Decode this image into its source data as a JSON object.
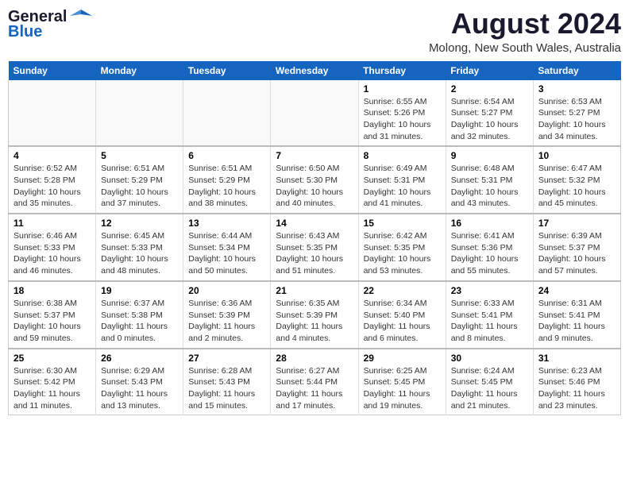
{
  "header": {
    "logo_line1": "General",
    "logo_line2": "Blue",
    "month_year": "August 2024",
    "location": "Molong, New South Wales, Australia"
  },
  "days_of_week": [
    "Sunday",
    "Monday",
    "Tuesday",
    "Wednesday",
    "Thursday",
    "Friday",
    "Saturday"
  ],
  "weeks": [
    [
      {
        "day": "",
        "info": ""
      },
      {
        "day": "",
        "info": ""
      },
      {
        "day": "",
        "info": ""
      },
      {
        "day": "",
        "info": ""
      },
      {
        "day": "1",
        "info": "Sunrise: 6:55 AM\nSunset: 5:26 PM\nDaylight: 10 hours and 31 minutes."
      },
      {
        "day": "2",
        "info": "Sunrise: 6:54 AM\nSunset: 5:27 PM\nDaylight: 10 hours and 32 minutes."
      },
      {
        "day": "3",
        "info": "Sunrise: 6:53 AM\nSunset: 5:27 PM\nDaylight: 10 hours and 34 minutes."
      }
    ],
    [
      {
        "day": "4",
        "info": "Sunrise: 6:52 AM\nSunset: 5:28 PM\nDaylight: 10 hours and 35 minutes."
      },
      {
        "day": "5",
        "info": "Sunrise: 6:51 AM\nSunset: 5:29 PM\nDaylight: 10 hours and 37 minutes."
      },
      {
        "day": "6",
        "info": "Sunrise: 6:51 AM\nSunset: 5:29 PM\nDaylight: 10 hours and 38 minutes."
      },
      {
        "day": "7",
        "info": "Sunrise: 6:50 AM\nSunset: 5:30 PM\nDaylight: 10 hours and 40 minutes."
      },
      {
        "day": "8",
        "info": "Sunrise: 6:49 AM\nSunset: 5:31 PM\nDaylight: 10 hours and 41 minutes."
      },
      {
        "day": "9",
        "info": "Sunrise: 6:48 AM\nSunset: 5:31 PM\nDaylight: 10 hours and 43 minutes."
      },
      {
        "day": "10",
        "info": "Sunrise: 6:47 AM\nSunset: 5:32 PM\nDaylight: 10 hours and 45 minutes."
      }
    ],
    [
      {
        "day": "11",
        "info": "Sunrise: 6:46 AM\nSunset: 5:33 PM\nDaylight: 10 hours and 46 minutes."
      },
      {
        "day": "12",
        "info": "Sunrise: 6:45 AM\nSunset: 5:33 PM\nDaylight: 10 hours and 48 minutes."
      },
      {
        "day": "13",
        "info": "Sunrise: 6:44 AM\nSunset: 5:34 PM\nDaylight: 10 hours and 50 minutes."
      },
      {
        "day": "14",
        "info": "Sunrise: 6:43 AM\nSunset: 5:35 PM\nDaylight: 10 hours and 51 minutes."
      },
      {
        "day": "15",
        "info": "Sunrise: 6:42 AM\nSunset: 5:35 PM\nDaylight: 10 hours and 53 minutes."
      },
      {
        "day": "16",
        "info": "Sunrise: 6:41 AM\nSunset: 5:36 PM\nDaylight: 10 hours and 55 minutes."
      },
      {
        "day": "17",
        "info": "Sunrise: 6:39 AM\nSunset: 5:37 PM\nDaylight: 10 hours and 57 minutes."
      }
    ],
    [
      {
        "day": "18",
        "info": "Sunrise: 6:38 AM\nSunset: 5:37 PM\nDaylight: 10 hours and 59 minutes."
      },
      {
        "day": "19",
        "info": "Sunrise: 6:37 AM\nSunset: 5:38 PM\nDaylight: 11 hours and 0 minutes."
      },
      {
        "day": "20",
        "info": "Sunrise: 6:36 AM\nSunset: 5:39 PM\nDaylight: 11 hours and 2 minutes."
      },
      {
        "day": "21",
        "info": "Sunrise: 6:35 AM\nSunset: 5:39 PM\nDaylight: 11 hours and 4 minutes."
      },
      {
        "day": "22",
        "info": "Sunrise: 6:34 AM\nSunset: 5:40 PM\nDaylight: 11 hours and 6 minutes."
      },
      {
        "day": "23",
        "info": "Sunrise: 6:33 AM\nSunset: 5:41 PM\nDaylight: 11 hours and 8 minutes."
      },
      {
        "day": "24",
        "info": "Sunrise: 6:31 AM\nSunset: 5:41 PM\nDaylight: 11 hours and 9 minutes."
      }
    ],
    [
      {
        "day": "25",
        "info": "Sunrise: 6:30 AM\nSunset: 5:42 PM\nDaylight: 11 hours and 11 minutes."
      },
      {
        "day": "26",
        "info": "Sunrise: 6:29 AM\nSunset: 5:43 PM\nDaylight: 11 hours and 13 minutes."
      },
      {
        "day": "27",
        "info": "Sunrise: 6:28 AM\nSunset: 5:43 PM\nDaylight: 11 hours and 15 minutes."
      },
      {
        "day": "28",
        "info": "Sunrise: 6:27 AM\nSunset: 5:44 PM\nDaylight: 11 hours and 17 minutes."
      },
      {
        "day": "29",
        "info": "Sunrise: 6:25 AM\nSunset: 5:45 PM\nDaylight: 11 hours and 19 minutes."
      },
      {
        "day": "30",
        "info": "Sunrise: 6:24 AM\nSunset: 5:45 PM\nDaylight: 11 hours and 21 minutes."
      },
      {
        "day": "31",
        "info": "Sunrise: 6:23 AM\nSunset: 5:46 PM\nDaylight: 11 hours and 23 minutes."
      }
    ]
  ]
}
